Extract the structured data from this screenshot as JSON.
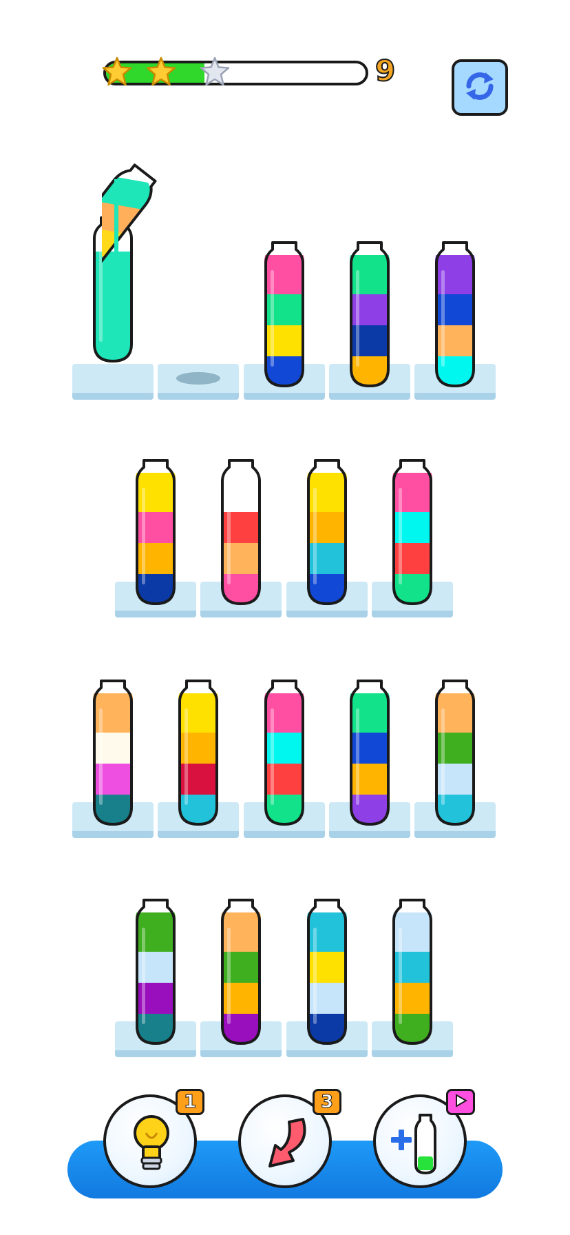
{
  "hud": {
    "progress_fraction": 0.38,
    "stars_total": 3,
    "stars_earned": 2,
    "level": "9",
    "restart_icon": "restart-icon"
  },
  "colors": {
    "green_fill": "#2fd82a",
    "star_gold": "#ffcc33",
    "star_gray": "#e2e6ee",
    "tube_base": "#cde9f6",
    "bottom_bar": "#1e9af7"
  },
  "pouring": {
    "source_tube_layers": [
      "#22c2da",
      "#ffd91a",
      "#ffaf5a",
      "#1ee6b8"
    ],
    "target_tube_fill": "#1ee6b8",
    "target_tube_fill_fraction": 0.85
  },
  "rows": [
    {
      "tubes": [
        {
          "id": "t1",
          "state": "receiving"
        },
        {
          "id": "t2",
          "state": "empty-slot"
        },
        {
          "id": "t3",
          "layers": [
            "#ff4fa3",
            "#12e28a",
            "#ffe100",
            "#1148d6"
          ]
        },
        {
          "id": "t4",
          "layers": [
            "#12e28a",
            "#8e3fe6",
            "#0b3aa6",
            "#ffb400"
          ]
        },
        {
          "id": "t5",
          "layers": [
            "#8e3fe6",
            "#1148d6",
            "#ffb35a",
            "#00f7f0"
          ]
        }
      ]
    },
    {
      "tubes": [
        {
          "id": "t6",
          "layers": [
            "#ffe100",
            "#ff4fa3",
            "#ffb400",
            "#0b3aa6"
          ]
        },
        {
          "id": "t7",
          "layers": [
            "#ff4040",
            "#ffb35a",
            "#ff4fa3"
          ]
        },
        {
          "id": "t8",
          "layers": [
            "#ffe100",
            "#ffb400",
            "#22c2da",
            "#1148d6"
          ]
        },
        {
          "id": "t9",
          "layers": [
            "#ff4fa3",
            "#00f7f0",
            "#ff4040",
            "#12e28a"
          ]
        }
      ]
    },
    {
      "tubes": [
        {
          "id": "t10",
          "layers": [
            "#ffb35a",
            "#fffaeb",
            "#ef4fe0",
            "#17808a"
          ]
        },
        {
          "id": "t11",
          "layers": [
            "#ffe100",
            "#ffb400",
            "#d9113f",
            "#22c2da"
          ]
        },
        {
          "id": "t12",
          "layers": [
            "#ff4fa3",
            "#00f7f0",
            "#ff4040",
            "#12e28a"
          ]
        },
        {
          "id": "t13",
          "layers": [
            "#12e28a",
            "#1148d6",
            "#ffb400",
            "#8e3fe6"
          ]
        },
        {
          "id": "t14",
          "layers": [
            "#ffb35a",
            "#3fae1f",
            "#c6e5fb",
            "#22c2da"
          ]
        }
      ]
    },
    {
      "tubes": [
        {
          "id": "t15",
          "layers": [
            "#3fae1f",
            "#c6e5fb",
            "#9a0fbd",
            "#17808a"
          ]
        },
        {
          "id": "t16",
          "layers": [
            "#ffb35a",
            "#3fae1f",
            "#ffb400",
            "#9a0fbd"
          ]
        },
        {
          "id": "t17",
          "layers": [
            "#22c2da",
            "#ffe100",
            "#c6e5fb",
            "#0b3aa6"
          ]
        },
        {
          "id": "t18",
          "layers": [
            "#c6e5fb",
            "#22c2da",
            "#ffb400",
            "#3fae1f"
          ]
        }
      ]
    }
  ],
  "powerups": [
    {
      "name": "hint",
      "icon": "lightbulb-icon",
      "badge": "1",
      "badge_color": "#ff9f1a"
    },
    {
      "name": "undo",
      "icon": "undo-arrow-icon",
      "badge": "3",
      "badge_color": "#ff9f1a"
    },
    {
      "name": "add-tube",
      "icon": "add-tube-icon",
      "badge_icon": "play-icon",
      "badge_color": "#ff4fe0"
    }
  ]
}
